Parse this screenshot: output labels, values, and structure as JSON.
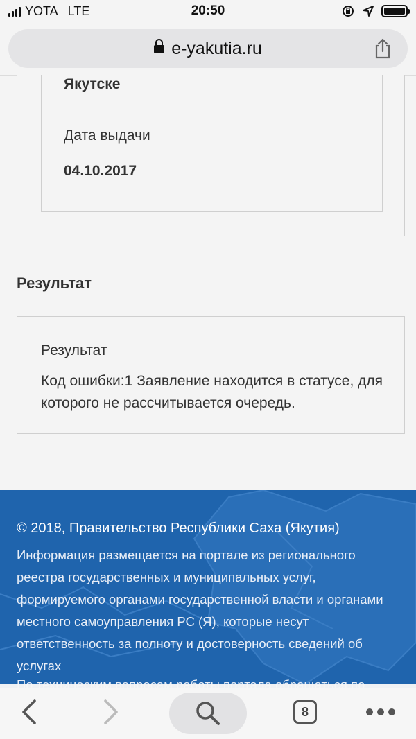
{
  "status_bar": {
    "carrier": "YOTA",
    "network": "LTE",
    "time": "20:50",
    "icons": [
      "signal-icon",
      "orientation-lock-icon",
      "location-icon",
      "battery-icon"
    ]
  },
  "address_bar": {
    "url": "e-yakutia.ru",
    "icons": [
      "lock-icon",
      "share-icon"
    ]
  },
  "document": {
    "issuer_value": "Якутске",
    "issue_date_label": "Дата выдачи",
    "issue_date_value": "04.10.2017"
  },
  "result_section": {
    "title": "Результат",
    "card_label": "Результат",
    "text": "Код ошибки:1 Заявление находится в статусе, для которого не рассчитывается очередь."
  },
  "footer": {
    "copyright": "© 2018, Правительство Республики Саха (Якутия)",
    "info": "Информация размещается на портале из регионального реестра государственных и муниципальных услуг, формируемого органами государственной власти и органами местного самоуправления РС (Я), которые несут ответственность за полноту и достоверность сведений об услугах",
    "support": "По техническим вопросам работы портала обращаться по"
  },
  "toolbar": {
    "tabs_count": "8",
    "icons": [
      "back-icon",
      "forward-icon",
      "search-icon",
      "tabs-icon",
      "more-icon"
    ]
  },
  "colors": {
    "page_bg": "#f4f4f4",
    "footer_bg": "#1f64ad",
    "border": "#cfcfcf",
    "text": "#333333"
  }
}
